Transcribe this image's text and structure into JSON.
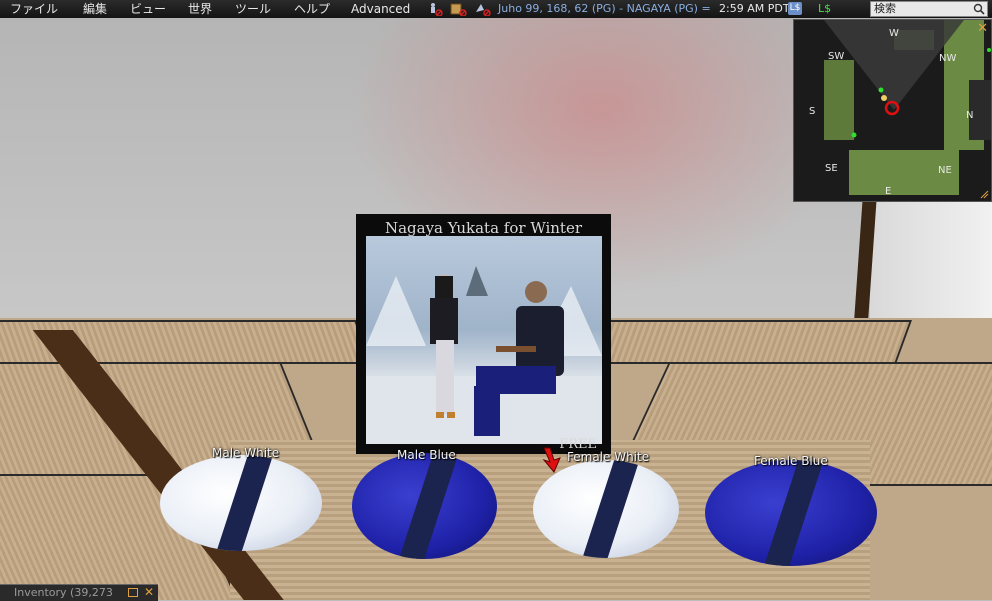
{
  "menubar": {
    "items": [
      "ファイル",
      "編集",
      "ビュー",
      "世界",
      "ツール",
      "ヘルプ",
      "Advanced"
    ],
    "location": "Juho 99, 168, 62 (PG) - NAGAYA (PG) =",
    "time": "2:59 AM PDT",
    "currency_badge": "L$",
    "currency": "L$",
    "search_placeholder": "検索"
  },
  "minimap": {
    "compass": {
      "w": "W",
      "nw": "NW",
      "sw": "SW",
      "s": "S",
      "n": "N",
      "se": "SE",
      "ne": "NE",
      "e": "E"
    },
    "close": "✕"
  },
  "poster": {
    "title": "Nagaya Yukata for Winter",
    "free": "FREE"
  },
  "objects": {
    "male_white": "Male White",
    "male_blue": "Male Blue",
    "female_white": "Female White",
    "female_blue": "Female Blue"
  },
  "inventory": {
    "title": "Inventory (39,273",
    "close": "✕"
  },
  "icons": {
    "toolbar": [
      "fly-icon",
      "build-icon",
      "script-icon"
    ],
    "search": "search-icon",
    "pointer": "red-arrow-pointer"
  },
  "colors": {
    "location_text": "#8aaee0",
    "currency_text": "#48e048",
    "accent_orange": "#e0a040"
  }
}
